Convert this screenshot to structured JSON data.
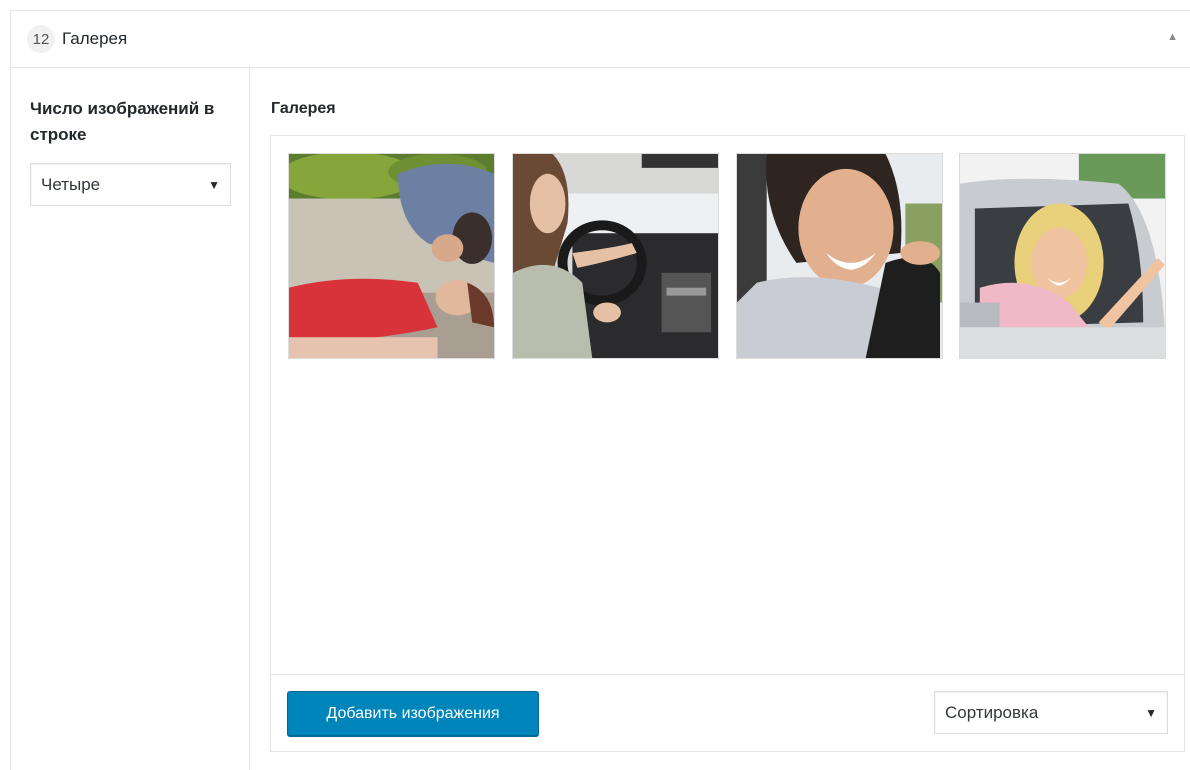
{
  "header": {
    "count_badge": "12",
    "title": "Галерея",
    "toggle_icon": "▲"
  },
  "sidebar": {
    "label": "Число изображений в строке",
    "rows_select": {
      "value": "Четыре",
      "arrow": "▼"
    }
  },
  "gallery": {
    "label": "Галерея",
    "thumbnails": [
      {
        "icon": "first-aid-photo"
      },
      {
        "icon": "driving-lesson-photo"
      },
      {
        "icon": "smiling-driver-photo"
      },
      {
        "icon": "happy-driver-window-photo"
      }
    ],
    "add_button": "Добавить изображения",
    "sort_select": {
      "value": "Сортировка",
      "arrow": "▼"
    }
  },
  "colors": {
    "accent": "#0085ba",
    "border": "#e5e5e5"
  }
}
